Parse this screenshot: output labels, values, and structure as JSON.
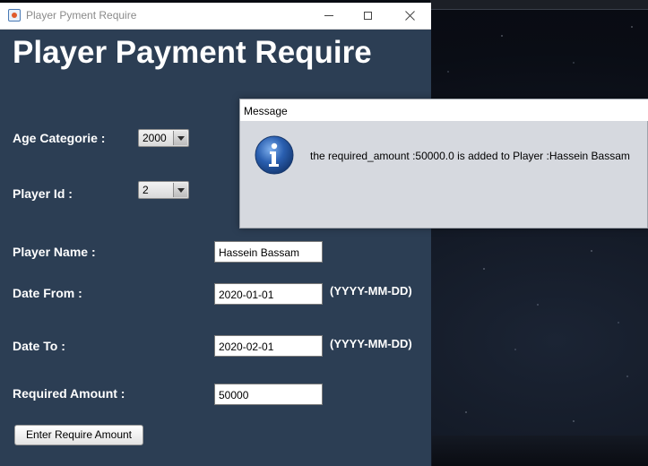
{
  "window": {
    "title": "Player Pyment Require",
    "heading": "Player Payment Require"
  },
  "form": {
    "age_label": "Age Categorie :",
    "age_value": "2000",
    "player_id_label": "Player Id :",
    "player_id_value": "2",
    "player_name_label": "Player Name :",
    "player_name_value": "Hassein Bassam",
    "date_from_label": "Date From :",
    "date_from_value": "2020-01-01",
    "date_to_label": "Date To :",
    "date_to_value": "2020-02-01",
    "date_format_hint": "(YYYY-MM-DD)",
    "amount_label": "Required Amount :",
    "amount_value": "50000",
    "submit_label": "Enter Require Amount"
  },
  "dialog": {
    "title": "Message",
    "message": "the required_amount :50000.0 is added to Player :Hassein Bassam",
    "icon": "info-icon"
  },
  "colors": {
    "window_bg": "#2c3e54",
    "icon_blue": "#2a5fb0"
  }
}
